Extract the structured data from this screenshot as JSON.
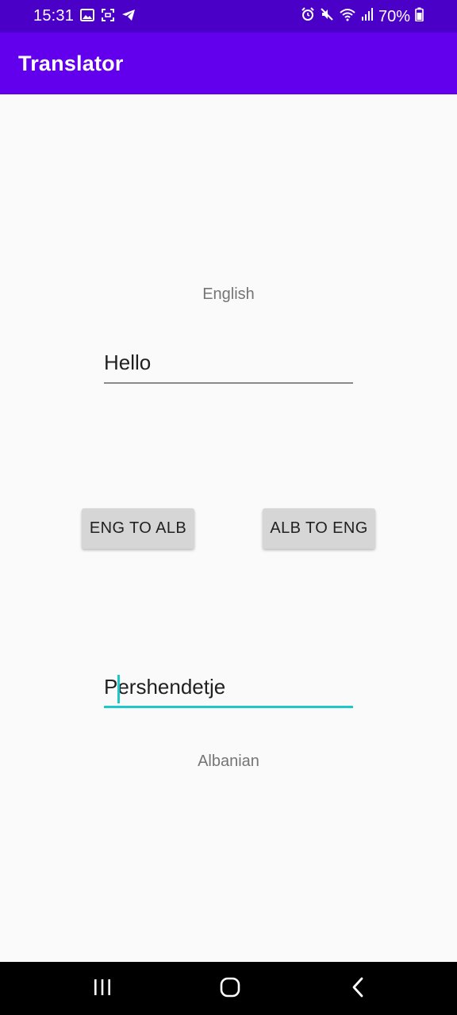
{
  "status_bar": {
    "time": "15:31",
    "battery": "70%",
    "left_icons": [
      "image-icon",
      "screenshot-icon",
      "telegram-icon"
    ],
    "right_icons": [
      "alarm-icon",
      "mute-icon",
      "wifi-icon",
      "signal-icon",
      "battery-icon"
    ]
  },
  "app_bar": {
    "title": "Translator"
  },
  "colors": {
    "status_bar": "#4b00c8",
    "app_bar": "#6200ee",
    "accent": "#1ec8c8",
    "background": "#fafafa"
  },
  "main": {
    "source_label": "English",
    "source_value": "Hello",
    "eng_to_alb_label": "ENG TO ALB",
    "alb_to_eng_label": "ALB TO ENG",
    "target_value": "Pershendetje",
    "target_label": "Albanian"
  },
  "nav_bar": {
    "icons": [
      "recents-icon",
      "home-icon",
      "back-icon"
    ]
  }
}
